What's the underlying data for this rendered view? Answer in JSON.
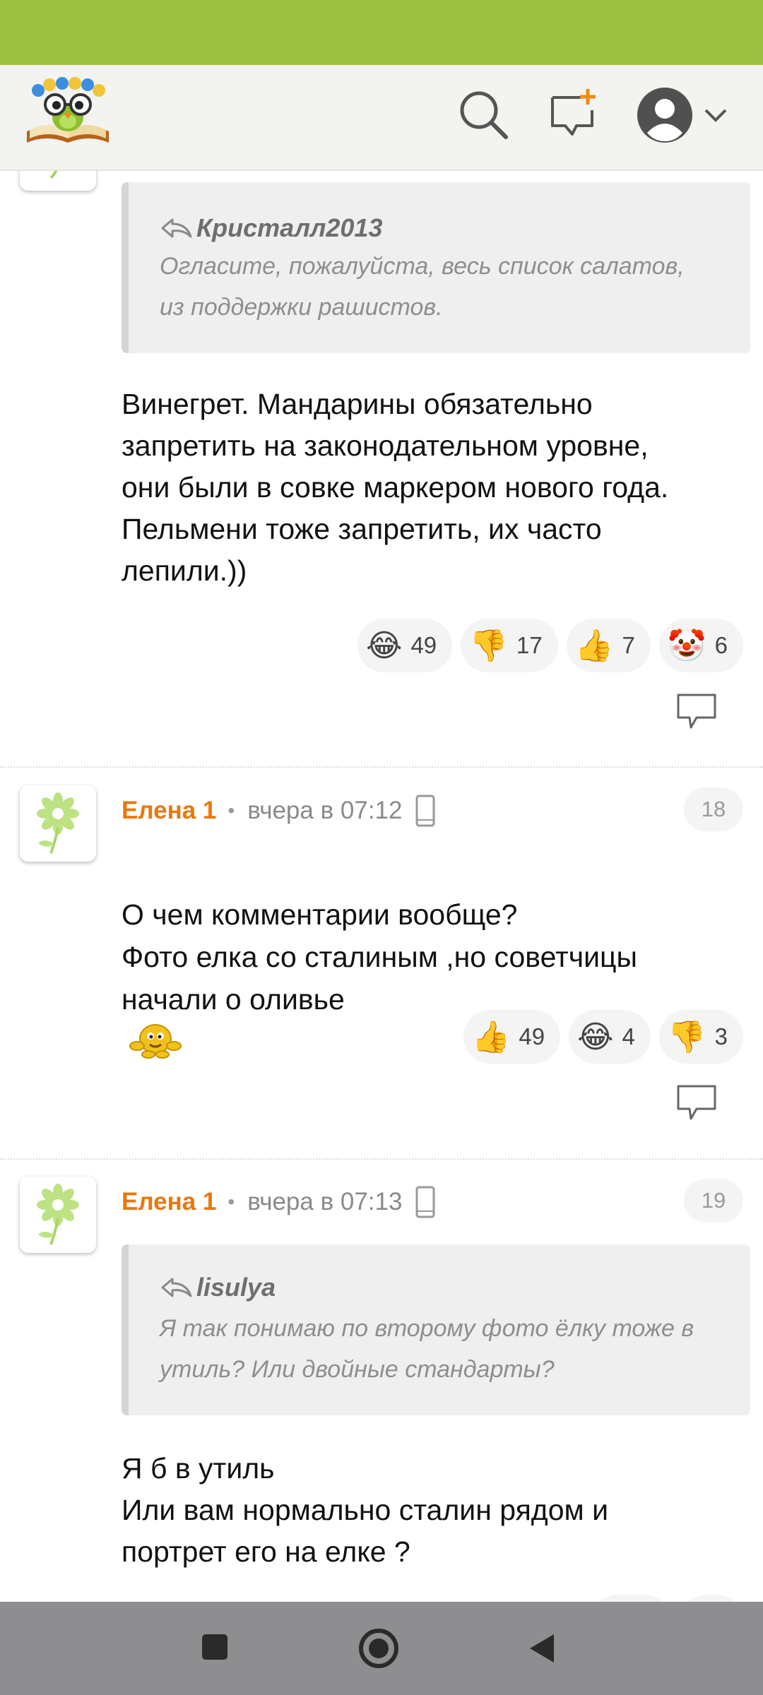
{
  "header": {
    "logo_icon": "owl-on-book-logo",
    "search_icon": "search-icon",
    "new_post_icon": "new-post-icon",
    "account_icon": "account-icon",
    "colors": {
      "status_bar": "#9ec043",
      "header_bg": "#f3f3f0",
      "accent": "#e8780c"
    }
  },
  "comments": [
    {
      "quote": {
        "author": "Кристалл2013",
        "text": "Огласите, пожалуйста, весь список салатов,\nиз поддержки рашистов."
      },
      "text": "Винегрет. Мандарины обязательно\nзапретить на законодательном уровне,\nони были в совке маркером нового года.\nПельмени тоже запретить, их часто\nлепили.))",
      "reactions": [
        {
          "emoji": "😂",
          "count": "49"
        },
        {
          "emoji": "👎",
          "count": "17"
        },
        {
          "emoji": "👍",
          "count": "7"
        },
        {
          "emoji": "🤡",
          "count": "6"
        }
      ]
    },
    {
      "author": "Елена 1",
      "time": "вчера в 07:12",
      "number": "18",
      "text": "О чем комментарии вообще?\nФото елка со сталиным ,но советчицы\nначали о оливье",
      "reactions": [
        {
          "emoji": "👍",
          "count": "49"
        },
        {
          "emoji": "😂",
          "count": "4"
        },
        {
          "emoji": "👎",
          "count": "3"
        }
      ]
    },
    {
      "author": "Елена 1",
      "time": "вчера в 07:13",
      "number": "19",
      "quote": {
        "author": "lisulya",
        "text": "Я так понимаю по второму фото ёлку тоже в\nутиль? Или двойные стандарты?"
      },
      "text": "Я б в утиль\nИли вам нормально сталин рядом и\nпортрет его на елке ?"
    }
  ],
  "navbar": {
    "recents_icon": "square-icon",
    "home_icon": "home-circle-icon",
    "back_icon": "back-triangle-icon"
  }
}
